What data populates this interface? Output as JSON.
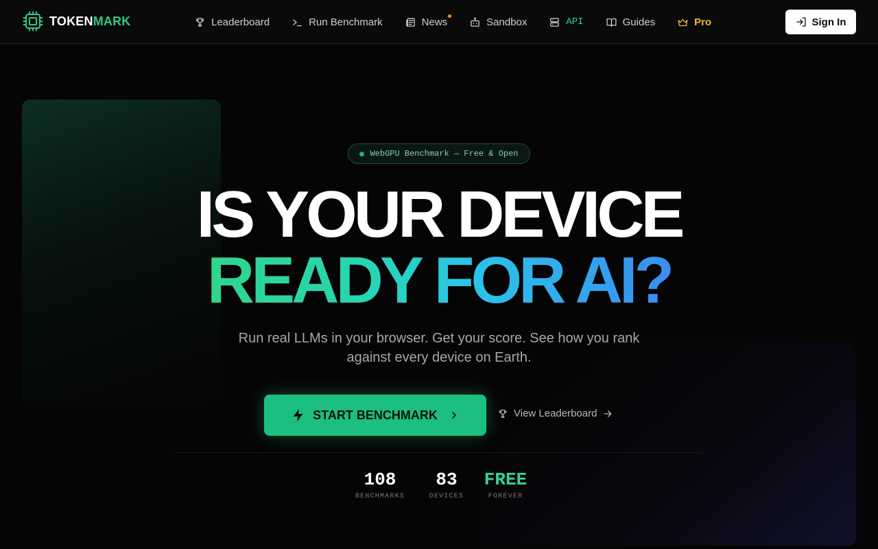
{
  "nav": {
    "logo_part1": "TOKEN",
    "logo_part2": "MARK",
    "items": [
      {
        "label": "Leaderboard",
        "icon": "trophy-icon"
      },
      {
        "label": "Run Benchmark",
        "icon": "terminal-icon"
      },
      {
        "label": "News",
        "icon": "newspaper-icon"
      },
      {
        "label": "Sandbox",
        "icon": "bot-icon"
      },
      {
        "label": "API",
        "icon": "server-icon"
      },
      {
        "label": "Guides",
        "icon": "book-icon"
      },
      {
        "label": "Pro",
        "icon": "crown-icon"
      }
    ],
    "signin_label": "Sign In"
  },
  "hero": {
    "badge": "WebGPU Benchmark — Free & Open",
    "headline_line1": "IS YOUR DEVICE",
    "headline_line2": "READY FOR AI?",
    "subtitle": "Run real LLMs in your browser. Get your score. See how you rank against every device on Earth.",
    "cta_label": "START BENCHMARK",
    "secondary_label": "View Leaderboard"
  },
  "stats": [
    {
      "value": "108",
      "label": "BENCHMARKS"
    },
    {
      "value": "83",
      "label": "DEVICES"
    },
    {
      "value": "FREE",
      "label": "FOREVER"
    }
  ],
  "colors": {
    "accent_green": "#1cbf80",
    "pro_gold": "#f5b82e",
    "news_dot": "#f28c28",
    "background": "#050505"
  }
}
